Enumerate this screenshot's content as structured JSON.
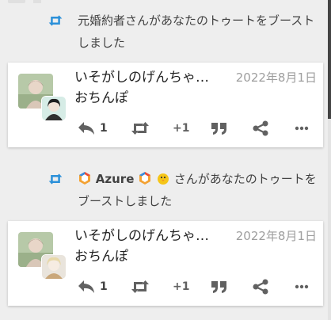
{
  "colors": {
    "background": "#eeeeee",
    "card": "#ffffff",
    "boost_icon": "#2b90d9",
    "action_icon": "#616161",
    "date_text": "#9e9e9e"
  },
  "notifications": [
    {
      "booster_text": "元婚約者さんがあなたのトゥートをブーストしました",
      "booster_icon": "boost-icon",
      "status": {
        "display_name": "いそがしのげんちゃ…",
        "date": "2022年8月1日",
        "content": "おちんぽ",
        "reply_count": "1",
        "favourite_label": "+1"
      }
    },
    {
      "booster_name": "Azure",
      "booster_suffix": "さんがあなたのトゥートをブーストしました",
      "booster_icon": "boost-icon",
      "status": {
        "display_name": "いそがしのげんちゃ…",
        "date": "2022年8月1日",
        "content": "おちんぽ",
        "reply_count": "1",
        "favourite_label": "+1"
      }
    }
  ]
}
